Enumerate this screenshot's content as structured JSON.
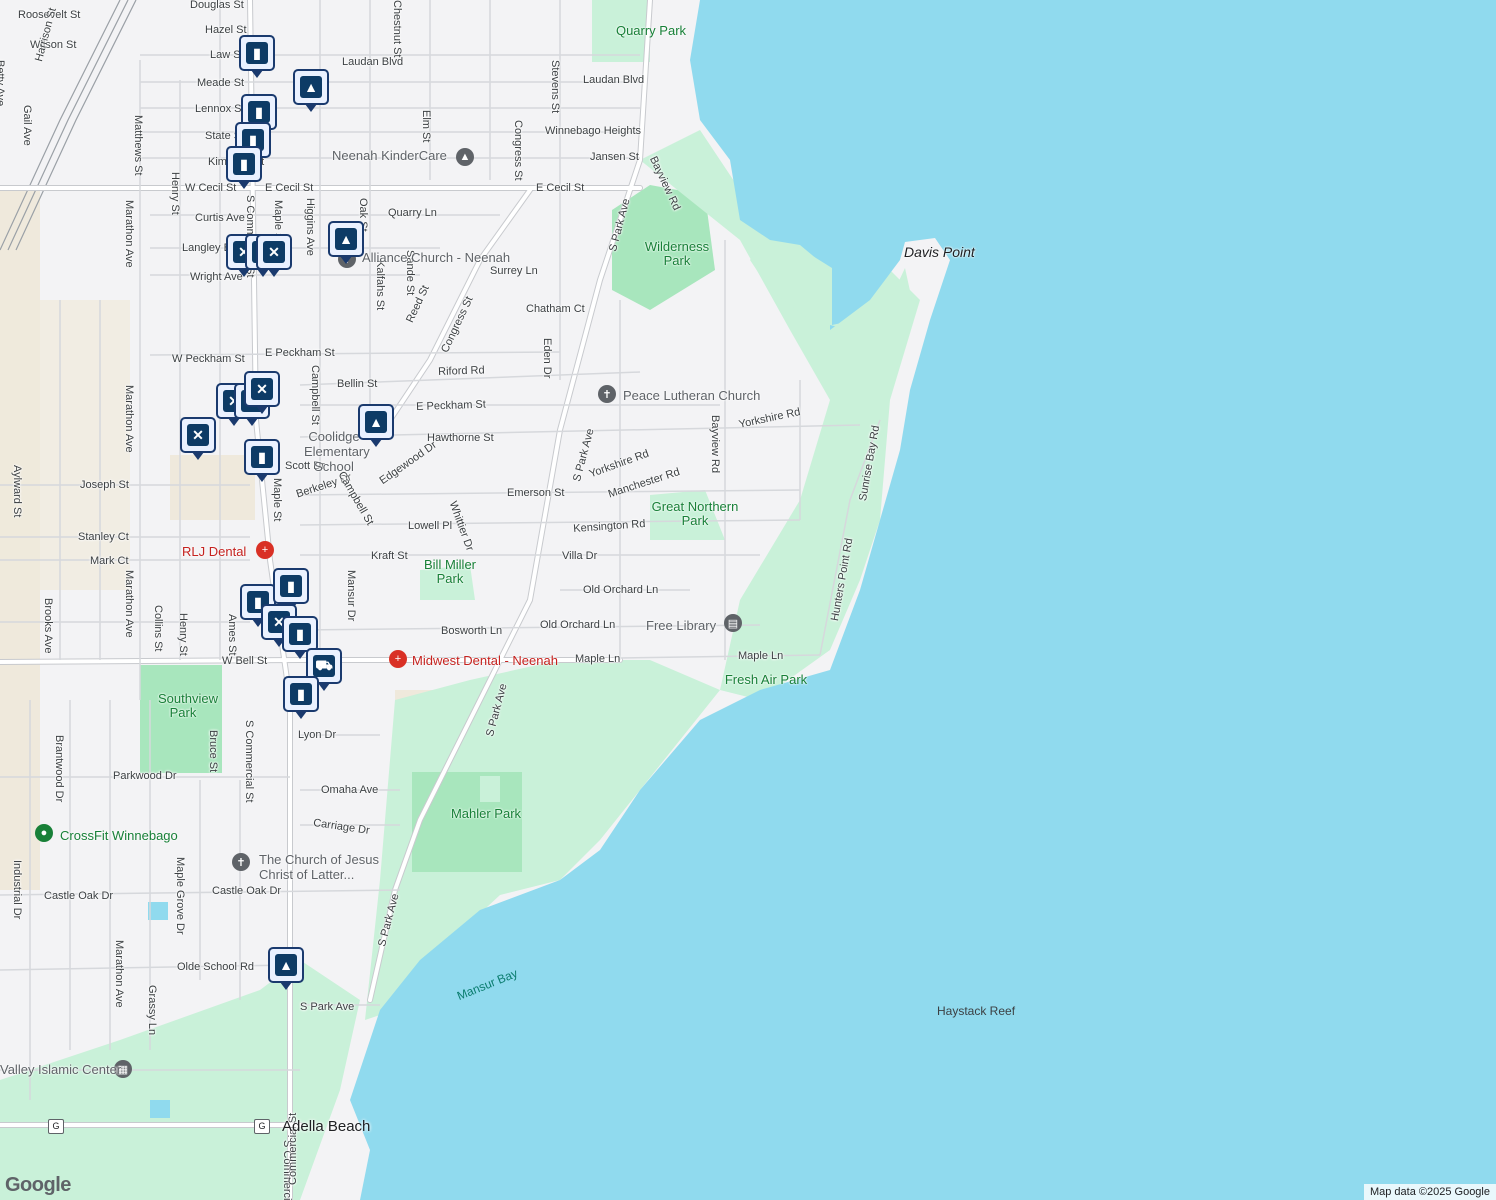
{
  "colors": {
    "water": "#90daee",
    "park": "#c9f1d9",
    "park_dark": "#a8e6bd",
    "road": "#ffffff",
    "road_outline": "#c8cace",
    "rail": "#9aa0a6",
    "pin_fill": "#0d3b66",
    "medical": "#d93025",
    "library": "#5f6368"
  },
  "streets": [
    {
      "name": "Roosevelt St"
    },
    {
      "name": "Douglas St"
    },
    {
      "name": "Hazel St"
    },
    {
      "name": "Wilson St"
    },
    {
      "name": "Law St"
    },
    {
      "name": "Laudan Blvd"
    },
    {
      "name": "Laudan Blvd"
    },
    {
      "name": "Meade St"
    },
    {
      "name": "Lennox St"
    },
    {
      "name": "State St"
    },
    {
      "name": "Kimberly St"
    },
    {
      "name": "Winnebago Heights"
    },
    {
      "name": "Jansen St"
    },
    {
      "name": "W Cecil St"
    },
    {
      "name": "E Cecil St"
    },
    {
      "name": "E Cecil St"
    },
    {
      "name": "Curtis Ave"
    },
    {
      "name": "Quarry Ln"
    },
    {
      "name": "Langley Blvd"
    },
    {
      "name": "Wright Ave"
    },
    {
      "name": "Surrey Ln"
    },
    {
      "name": "Chatham Ct"
    },
    {
      "name": "W Peckham St"
    },
    {
      "name": "E Peckham St"
    },
    {
      "name": "Bellin St"
    },
    {
      "name": "Riford Rd"
    },
    {
      "name": "E Peckham St"
    },
    {
      "name": "Hawthorne St"
    },
    {
      "name": "Yorkshire Rd"
    },
    {
      "name": "Yorkshire Rd"
    },
    {
      "name": "Scott Dr"
    },
    {
      "name": "Joseph St"
    },
    {
      "name": "Berkeley Dr"
    },
    {
      "name": "Edgewood Dr"
    },
    {
      "name": "Emerson St"
    },
    {
      "name": "Manchester Rd"
    },
    {
      "name": "Lowell Pl"
    },
    {
      "name": "Kensington Rd"
    },
    {
      "name": "Stanley Ct"
    },
    {
      "name": "Mark Ct"
    },
    {
      "name": "Kraft St"
    },
    {
      "name": "Villa Dr"
    },
    {
      "name": "Old Orchard Ln"
    },
    {
      "name": "Old Orchard Ln"
    },
    {
      "name": "Bosworth Ln"
    },
    {
      "name": "W Bell St"
    },
    {
      "name": "Maple Ln"
    },
    {
      "name": "Maple Ln"
    },
    {
      "name": "Lyon Dr"
    },
    {
      "name": "Parkwood Dr"
    },
    {
      "name": "Omaha Ave"
    },
    {
      "name": "Carriage Dr"
    },
    {
      "name": "Castle Oak Dr"
    },
    {
      "name": "Castle Oak Dr"
    },
    {
      "name": "Olde School Rd"
    },
    {
      "name": "S Park Ave"
    },
    {
      "name": "Harrison St"
    },
    {
      "name": "Betty Ave"
    },
    {
      "name": "Gail Ave"
    },
    {
      "name": "Matthews St"
    },
    {
      "name": "Henry St"
    },
    {
      "name": "Marathon Ave"
    },
    {
      "name": "Marathon Ave"
    },
    {
      "name": "Marathon Ave"
    },
    {
      "name": "S Commercial St"
    },
    {
      "name": "S Commercial St"
    },
    {
      "name": "S Commercial St"
    },
    {
      "name": "Maple St"
    },
    {
      "name": "Higgins Ave"
    },
    {
      "name": "Chestnut St"
    },
    {
      "name": "Oak St"
    },
    {
      "name": "Elm St"
    },
    {
      "name": "Sande St"
    },
    {
      "name": "Kalfahs St"
    },
    {
      "name": "Reed St"
    },
    {
      "name": "Congress St"
    },
    {
      "name": "Congress St"
    },
    {
      "name": "Stevens St"
    },
    {
      "name": "Eden Dr"
    },
    {
      "name": "S Park Ave"
    },
    {
      "name": "S Park Ave"
    },
    {
      "name": "S Park Ave"
    },
    {
      "name": "S Park Ave"
    },
    {
      "name": "Bayview Rd"
    },
    {
      "name": "Bayview Rd"
    },
    {
      "name": "Sunrise Bay Rd"
    },
    {
      "name": "Hunters Point Rd"
    },
    {
      "name": "Campbell St"
    },
    {
      "name": "Campbell St"
    },
    {
      "name": "Whittier Dr"
    },
    {
      "name": "Mansur Dr"
    },
    {
      "name": "Aylward St"
    },
    {
      "name": "Brooks Ave"
    },
    {
      "name": "Collins St"
    },
    {
      "name": "Henry St"
    },
    {
      "name": "Ames St"
    },
    {
      "name": "Brantwood Dr"
    },
    {
      "name": "Bruce St"
    },
    {
      "name": "Maple Grove Dr"
    },
    {
      "name": "Industrial Dr"
    },
    {
      "name": "Marathon Ave"
    },
    {
      "name": "Grassy Ln"
    },
    {
      "name": "Maple St"
    },
    {
      "name": "Commercial St"
    }
  ],
  "parks": [
    {
      "name": "Quarry Park"
    },
    {
      "name": "Wilderness Park"
    },
    {
      "name": "Great Northern Park"
    },
    {
      "name": "Bill Miller Park"
    },
    {
      "name": "Southview Park"
    },
    {
      "name": "Mahler Park"
    },
    {
      "name": "Fresh Air Park"
    }
  ],
  "places": [
    {
      "name": "Davis Point"
    },
    {
      "name": "Mansur Bay"
    },
    {
      "name": "Haystack Reef"
    },
    {
      "name": "Adella Beach"
    }
  ],
  "pois": [
    {
      "name": "Neenah KinderCare",
      "icon": "school-icon"
    },
    {
      "name": "Alliance Church - Neenah",
      "icon": "church-icon"
    },
    {
      "name": "Peace Lutheran Church",
      "icon": "church-icon"
    },
    {
      "name": "Coolidge Elementary School",
      "icon": "school-icon"
    },
    {
      "name": "RLJ Dental",
      "icon": "medical-icon"
    },
    {
      "name": "Midwest Dental - Neenah",
      "icon": "medical-icon"
    },
    {
      "name": "Free Library",
      "icon": "library-icon"
    },
    {
      "name": "CrossFit Winnebago",
      "icon": "fitness-icon"
    },
    {
      "name": "The Church of Jesus Christ of Latter...",
      "icon": "church-icon"
    },
    {
      "name": "Valley Islamic Center",
      "icon": "mosque-icon"
    }
  ],
  "markers": [
    {
      "type": "shopping-bag-icon",
      "glyph": "▮"
    },
    {
      "type": "school-icon",
      "glyph": "▲"
    },
    {
      "type": "shopping-bag-icon",
      "glyph": "▮"
    },
    {
      "type": "shopping-bag-icon",
      "glyph": "▮"
    },
    {
      "type": "shopping-bag-icon",
      "glyph": "▮"
    },
    {
      "type": "restaurant-icon",
      "glyph": "✕"
    },
    {
      "type": "restaurant-icon",
      "glyph": "✕"
    },
    {
      "type": "restaurant-icon",
      "glyph": "✕"
    },
    {
      "type": "school-icon",
      "glyph": "▲"
    },
    {
      "type": "restaurant-icon",
      "glyph": "✕"
    },
    {
      "type": "restaurant-icon",
      "glyph": "✕"
    },
    {
      "type": "restaurant-icon",
      "glyph": "✕"
    },
    {
      "type": "school-icon",
      "glyph": "▲"
    },
    {
      "type": "shopping-bag-icon",
      "glyph": "▮"
    },
    {
      "type": "restaurant-icon",
      "glyph": "✕"
    },
    {
      "type": "shopping-bag-icon",
      "glyph": "▮"
    },
    {
      "type": "shopping-bag-icon",
      "glyph": "▮"
    },
    {
      "type": "restaurant-icon",
      "glyph": "✕"
    },
    {
      "type": "shopping-bag-icon",
      "glyph": "▮"
    },
    {
      "type": "shopping-cart-icon",
      "glyph": "⛟"
    },
    {
      "type": "shopping-bag-icon",
      "glyph": "▮"
    },
    {
      "type": "school-icon",
      "glyph": "▲"
    }
  ],
  "shields": [
    {
      "label": "G"
    },
    {
      "label": "G"
    }
  ],
  "logo": "Google",
  "attribution": "Map data ©2025 Google"
}
